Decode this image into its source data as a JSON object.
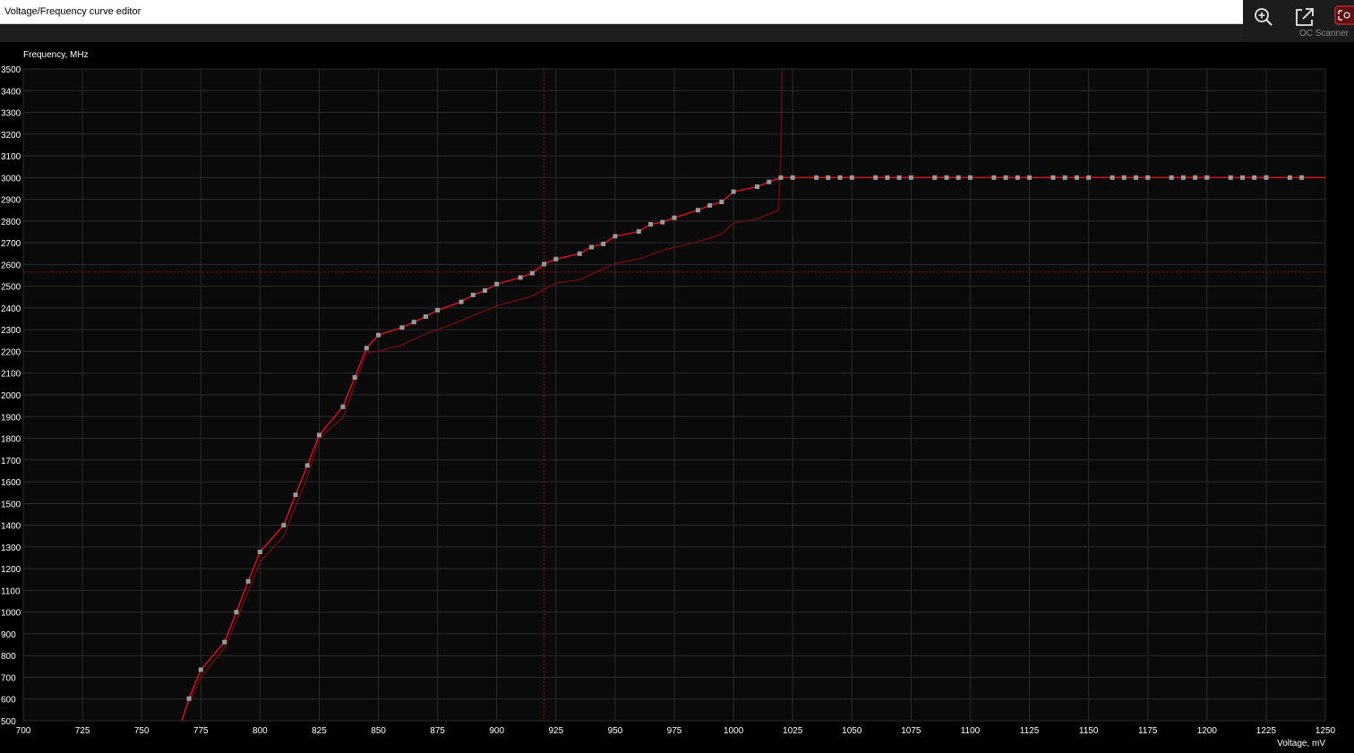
{
  "window": {
    "title": "Voltage/Frequency curve editor"
  },
  "toolbar": {
    "oc_scanner_label": "OC Scanner"
  },
  "colors": {
    "background": "#000000",
    "plot_background": "#0a0a0a",
    "grid": "#2b2b2b",
    "curve": "#e0141e",
    "curve_previous": "#7a0b12",
    "points": "#9a9a9a",
    "text": "#ffffff",
    "crosshair": "#8a1018"
  },
  "chart_data": {
    "type": "line",
    "ylabel": "Frequency, MHz",
    "xlabel": "Voltage, mV",
    "xlim": [
      700,
      1250
    ],
    "ylim": [
      500,
      3500
    ],
    "x_ticks": [
      700,
      725,
      750,
      775,
      800,
      825,
      850,
      875,
      900,
      925,
      950,
      975,
      1000,
      1025,
      1050,
      1075,
      1100,
      1125,
      1150,
      1175,
      1200,
      1225,
      1250
    ],
    "y_ticks": [
      500,
      600,
      700,
      800,
      900,
      1000,
      1100,
      1200,
      1300,
      1400,
      1500,
      1600,
      1700,
      1800,
      1900,
      2000,
      2100,
      2200,
      2300,
      2400,
      2500,
      2600,
      2700,
      2800,
      2900,
      3000,
      3100,
      3200,
      3300,
      3400,
      3500
    ],
    "grid": true,
    "crosshair": {
      "x": 920,
      "y": 2565
    },
    "series": [
      {
        "role": "current",
        "points": [
          [
            767,
            500
          ],
          [
            770,
            602
          ],
          [
            775,
            735
          ],
          [
            785,
            862
          ],
          [
            790,
            1000
          ],
          [
            795,
            1142
          ],
          [
            800,
            1277
          ],
          [
            810,
            1400
          ],
          [
            815,
            1540
          ],
          [
            820,
            1675
          ],
          [
            825,
            1815
          ],
          [
            835,
            1945
          ],
          [
            840,
            2080
          ],
          [
            845,
            2215
          ],
          [
            850,
            2275
          ],
          [
            860,
            2310
          ],
          [
            865,
            2335
          ],
          [
            870,
            2360
          ],
          [
            875,
            2390
          ],
          [
            885,
            2428
          ],
          [
            890,
            2460
          ],
          [
            895,
            2480
          ],
          [
            900,
            2510
          ],
          [
            910,
            2540
          ],
          [
            915,
            2560
          ],
          [
            920,
            2602
          ],
          [
            925,
            2625
          ],
          [
            935,
            2650
          ],
          [
            940,
            2680
          ],
          [
            945,
            2695
          ],
          [
            950,
            2730
          ],
          [
            960,
            2752
          ],
          [
            965,
            2785
          ],
          [
            970,
            2795
          ],
          [
            975,
            2815
          ],
          [
            985,
            2850
          ],
          [
            990,
            2872
          ],
          [
            995,
            2888
          ],
          [
            1000,
            2935
          ],
          [
            1010,
            2958
          ],
          [
            1015,
            2980
          ],
          [
            1020,
            3000
          ],
          [
            1025,
            3000
          ],
          [
            1035,
            3000
          ],
          [
            1040,
            3000
          ],
          [
            1045,
            3000
          ],
          [
            1050,
            3000
          ],
          [
            1060,
            3000
          ],
          [
            1065,
            3000
          ],
          [
            1070,
            3000
          ],
          [
            1075,
            3000
          ],
          [
            1085,
            3000
          ],
          [
            1090,
            3000
          ],
          [
            1095,
            3000
          ],
          [
            1100,
            3000
          ],
          [
            1110,
            3000
          ],
          [
            1115,
            3000
          ],
          [
            1120,
            3000
          ],
          [
            1125,
            3000
          ],
          [
            1135,
            3000
          ],
          [
            1140,
            3000
          ],
          [
            1145,
            3000
          ],
          [
            1150,
            3000
          ],
          [
            1160,
            3000
          ],
          [
            1165,
            3000
          ],
          [
            1170,
            3000
          ],
          [
            1175,
            3000
          ],
          [
            1185,
            3000
          ],
          [
            1190,
            3000
          ],
          [
            1195,
            3000
          ],
          [
            1200,
            3000
          ],
          [
            1210,
            3000
          ],
          [
            1215,
            3000
          ],
          [
            1220,
            3000
          ],
          [
            1225,
            3000
          ],
          [
            1235,
            3000
          ],
          [
            1240,
            3000
          ],
          [
            1250,
            3000
          ]
        ],
        "markers_end": 1240
      },
      {
        "role": "previous",
        "points": [
          [
            770,
            580
          ],
          [
            775,
            700
          ],
          [
            785,
            835
          ],
          [
            790,
            960
          ],
          [
            800,
            1230
          ],
          [
            810,
            1350
          ],
          [
            820,
            1620
          ],
          [
            825,
            1800
          ],
          [
            835,
            1895
          ],
          [
            845,
            2195
          ],
          [
            850,
            2200
          ],
          [
            860,
            2230
          ],
          [
            870,
            2280
          ],
          [
            880,
            2320
          ],
          [
            890,
            2365
          ],
          [
            900,
            2410
          ],
          [
            915,
            2455
          ],
          [
            925,
            2515
          ],
          [
            935,
            2530
          ],
          [
            950,
            2605
          ],
          [
            960,
            2625
          ],
          [
            970,
            2665
          ],
          [
            985,
            2705
          ],
          [
            995,
            2740
          ],
          [
            1000,
            2790
          ],
          [
            1010,
            2810
          ],
          [
            1019,
            2850
          ],
          [
            1020,
            3100
          ],
          [
            1020.5,
            3500
          ]
        ]
      }
    ]
  }
}
